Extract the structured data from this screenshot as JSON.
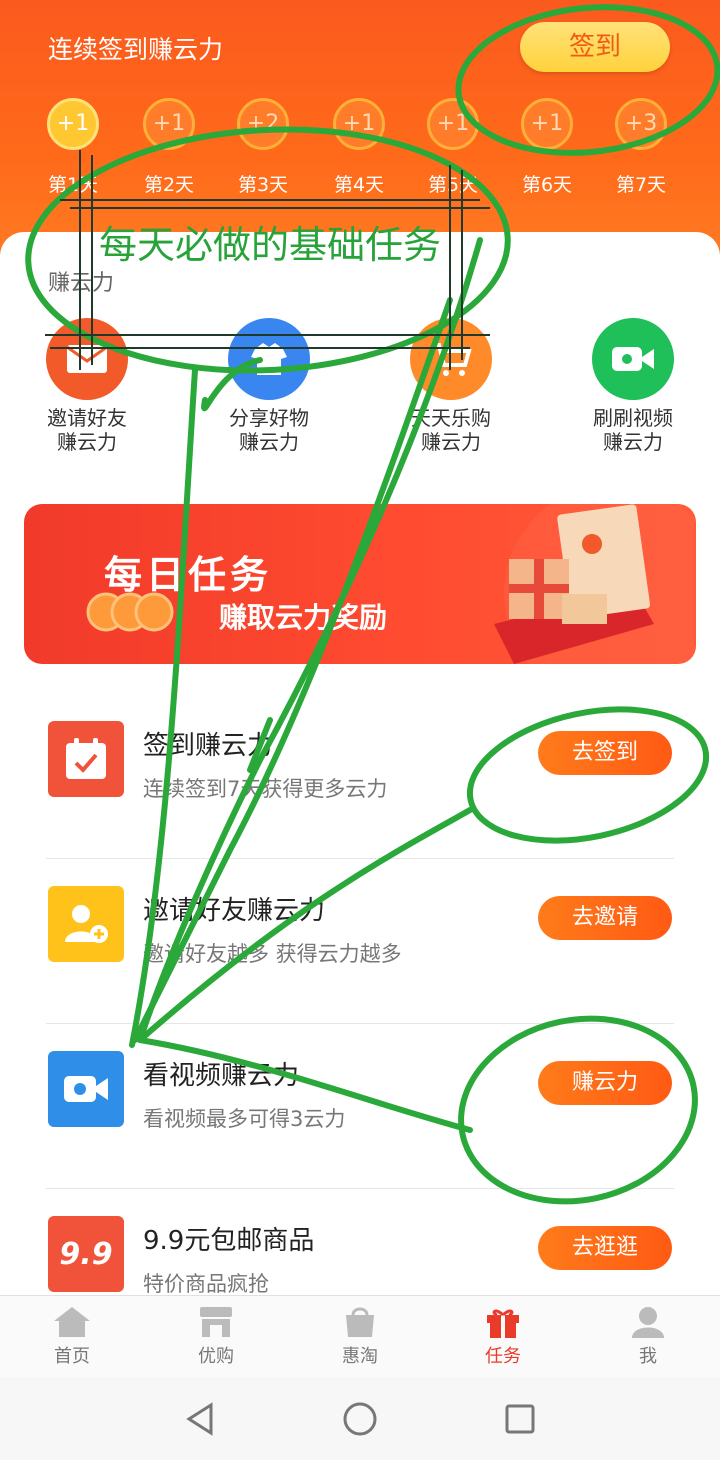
{
  "header": {
    "title": "连续签到赚云力",
    "checkin_button": "签到",
    "days": [
      {
        "reward": "+1",
        "label": "第1天"
      },
      {
        "reward": "+1",
        "label": "第2天"
      },
      {
        "reward": "+2",
        "label": "第3天"
      },
      {
        "reward": "+1",
        "label": "第4天"
      },
      {
        "reward": "+1",
        "label": "第5天"
      },
      {
        "reward": "+1",
        "label": "第6天"
      },
      {
        "reward": "+3",
        "label": "第7天"
      }
    ]
  },
  "section": {
    "title": "赚云力"
  },
  "shortcuts": [
    {
      "line1": "邀请好友",
      "line2": "赚云力",
      "icon": "mail-icon",
      "color": "#f25a2a"
    },
    {
      "line1": "分享好物",
      "line2": "赚云力",
      "icon": "gift-shirt-icon",
      "color": "#3a86f0"
    },
    {
      "line1": "天天乐购",
      "line2": "赚云力",
      "icon": "cart-icon",
      "color": "#ff8a2a"
    },
    {
      "line1": "刷刷视频",
      "line2": "赚云力",
      "icon": "video-icon",
      "color": "#1fbf5a"
    }
  ],
  "banner": {
    "title": "每日任务",
    "subtitle": "赚取云力奖励"
  },
  "tasks": [
    {
      "name": "签到赚云力",
      "desc": "连续签到7天获得更多云力",
      "button": "去签到",
      "icon": "calendar-icon",
      "color": "#f0533a"
    },
    {
      "name": "邀请好友赚云力",
      "desc": "邀请好友越多 获得云力越多",
      "button": "去邀请",
      "icon": "add-user-icon",
      "color": "#ffc21a"
    },
    {
      "name": "看视频赚云力",
      "desc": "看视频最多可得3云力",
      "button": "赚云力",
      "icon": "video-icon",
      "color": "#2f8fe8"
    },
    {
      "name": "9.9元包邮商品",
      "desc": "特价商品疯抢",
      "button": "去逛逛",
      "icon": "price-9-9-icon",
      "color": "#f0533a",
      "badge": "9.9"
    }
  ],
  "tabbar": [
    {
      "label": "首页",
      "icon": "home-icon"
    },
    {
      "label": "优购",
      "icon": "store-icon"
    },
    {
      "label": "惠淘",
      "icon": "shop-icon"
    },
    {
      "label": "任务",
      "icon": "gift-icon",
      "active": true
    },
    {
      "label": "我",
      "icon": "user-icon"
    }
  ],
  "annotation": {
    "text": "每天必做的基础任务"
  },
  "colors": {
    "primary": "#ff6a1a",
    "annotation": "#27a33a",
    "active_tab": "#e93a2a"
  }
}
